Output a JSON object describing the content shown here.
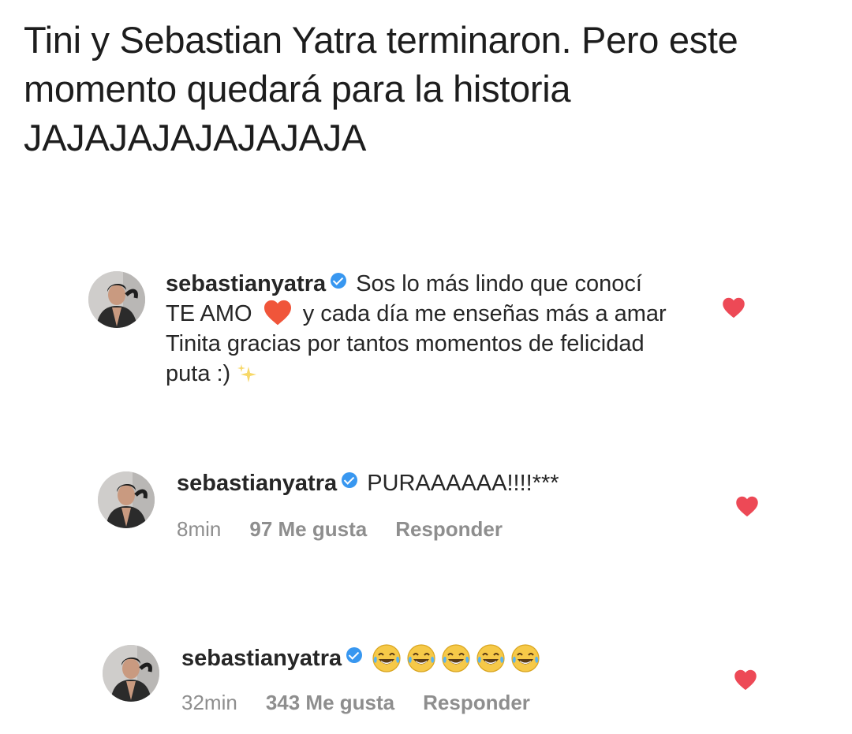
{
  "headline": "Tini y Sebastian Yatra terminaron. Pero este momento quedará para la historia JAJAJAJAJAJAJAJA",
  "colors": {
    "heart": "#ed4956",
    "verified": "#3897f0",
    "meta": "#8e8e8e",
    "text": "#262626"
  },
  "comments": [
    {
      "username": "sebastianyatra",
      "verified": true,
      "text_part1": "Sos lo más lindo que conocí TE AMO",
      "text_emoji": "red-heart",
      "text_part2": "y cada día me enseñas más a amar Tinita gracias por tantos momentos de felicidad puta :)",
      "text_end_emoji": "sparkles",
      "liked": true
    },
    {
      "username": "sebastianyatra",
      "verified": true,
      "text": "PURAAAAAA!!!!***",
      "time": "8min",
      "likes": "97 Me gusta",
      "reply": "Responder",
      "liked": true
    },
    {
      "username": "sebastianyatra",
      "verified": true,
      "emojis": [
        "crying-laughing-face",
        "crying-laughing-face",
        "crying-laughing-face",
        "crying-laughing-face",
        "crying-laughing-face"
      ],
      "time": "32min",
      "likes": "343 Me gusta",
      "reply": "Responder",
      "liked": true
    }
  ]
}
